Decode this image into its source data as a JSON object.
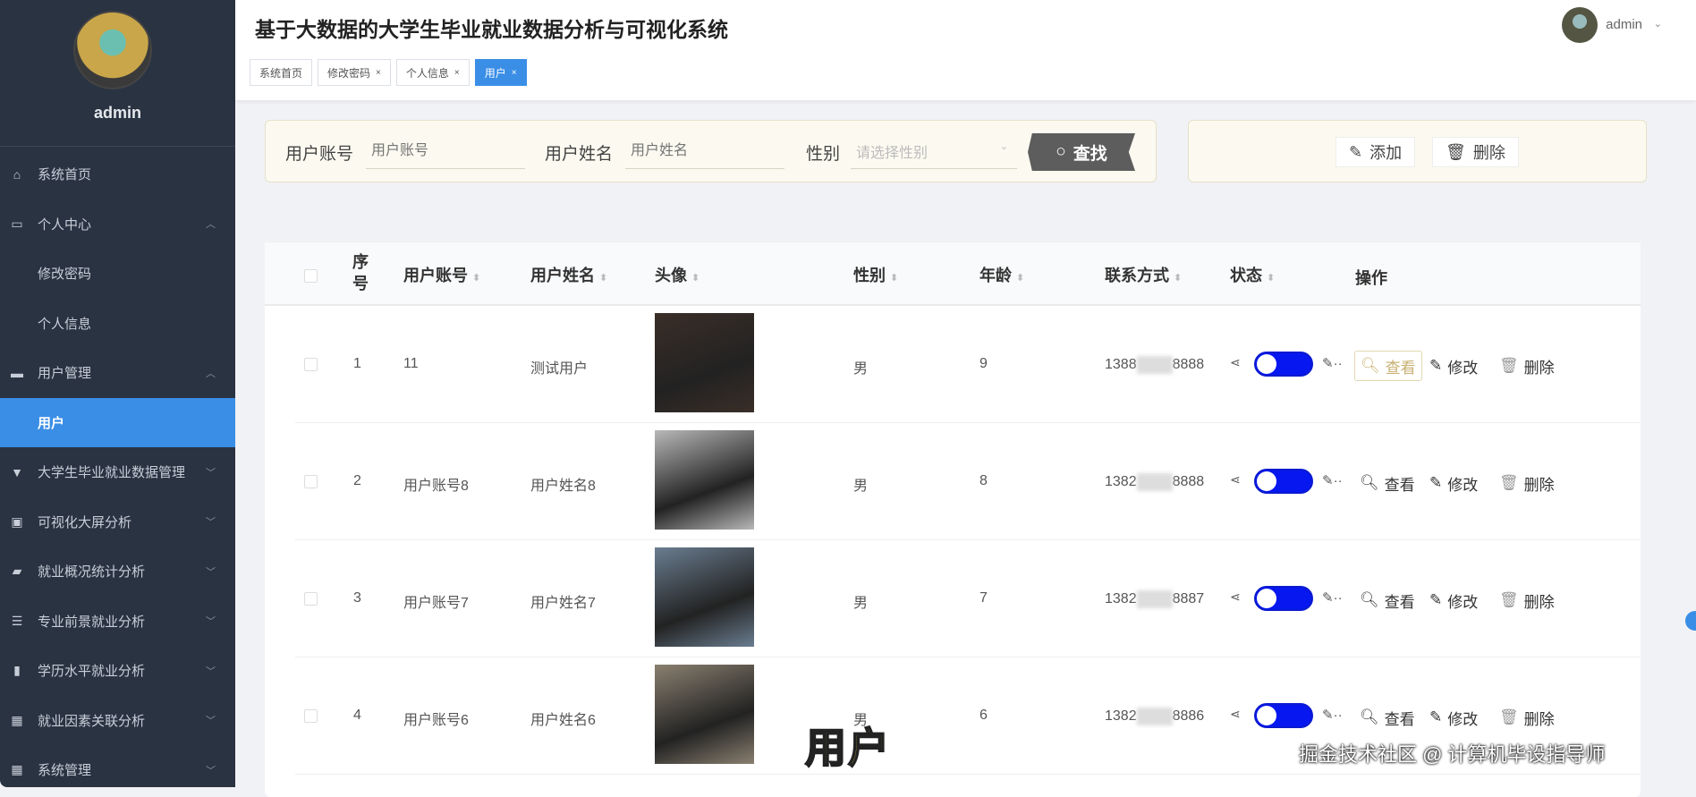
{
  "sidebar": {
    "username": "admin",
    "items": [
      {
        "label": "系统首页",
        "icon": "home-icon",
        "sub": false,
        "chev": ""
      },
      {
        "label": "个人中心",
        "icon": "card-icon",
        "sub": false,
        "chev": "^"
      },
      {
        "label": "修改密码",
        "sub": true
      },
      {
        "label": "个人信息",
        "sub": true
      },
      {
        "label": "用户管理",
        "icon": "wallet-icon",
        "sub": false,
        "chev": "^"
      },
      {
        "label": "用户",
        "sub": true,
        "active": true
      },
      {
        "label": "大学生毕业就业数据管理",
        "icon": "brush-icon",
        "chev": "v"
      },
      {
        "label": "可视化大屏分析",
        "icon": "clipboard-icon",
        "chev": "v"
      },
      {
        "label": "就业概况统计分析",
        "icon": "box-icon",
        "chev": "v"
      },
      {
        "label": "专业前景就业分析",
        "icon": "sliders-icon",
        "chev": "v"
      },
      {
        "label": "学历水平就业分析",
        "icon": "book-icon",
        "chev": "v"
      },
      {
        "label": "就业因素关联分析",
        "icon": "grid-icon",
        "chev": "v"
      },
      {
        "label": "系统管理",
        "icon": "apps-icon",
        "chev": "v"
      }
    ]
  },
  "header": {
    "title": "基于大数据的大学生毕业就业数据分析与可视化系统",
    "user": "admin",
    "tabs": [
      {
        "label": "系统首页",
        "closable": false
      },
      {
        "label": "修改密码",
        "closable": true
      },
      {
        "label": "个人信息",
        "closable": true
      },
      {
        "label": "用户",
        "closable": true,
        "active": true
      }
    ]
  },
  "search": {
    "account_label": "用户账号",
    "account_placeholder": "用户账号",
    "name_label": "用户姓名",
    "name_placeholder": "用户姓名",
    "gender_label": "性别",
    "gender_placeholder": "请选择性别",
    "find": "查找"
  },
  "actions": {
    "add": "添加",
    "delete": "删除"
  },
  "table": {
    "headers": {
      "index": "序号",
      "account": "用户账号",
      "name": "用户姓名",
      "avatar": "头像",
      "gender": "性别",
      "age": "年龄",
      "phone": "联系方式",
      "status": "状态",
      "ops": "操作"
    },
    "ops": {
      "view": "查看",
      "edit": "修改",
      "delete": "删除"
    },
    "rows": [
      {
        "index": "1",
        "account": "11",
        "name": "测试用户",
        "gender": "男",
        "age": "9",
        "phone_a": "1388",
        "phone_b": "8888",
        "status": true,
        "photo": "#3a2e28"
      },
      {
        "index": "2",
        "account": "用户账号8",
        "name": "用户姓名8",
        "gender": "男",
        "age": "8",
        "phone_a": "1382",
        "phone_b": "8888",
        "status": true,
        "photo": "#b8b8b8"
      },
      {
        "index": "3",
        "account": "用户账号7",
        "name": "用户姓名7",
        "gender": "男",
        "age": "7",
        "phone_a": "1382",
        "phone_b": "8887",
        "status": true,
        "photo": "#6a7d90"
      },
      {
        "index": "4",
        "account": "用户账号6",
        "name": "用户姓名6",
        "gender": "男",
        "age": "6",
        "phone_a": "1382",
        "phone_b": "8886",
        "status": true,
        "photo": "#8a8070"
      }
    ]
  },
  "overlay": {
    "caption": "用户",
    "watermark": "掘金技术社区 @ 计算机毕设指导师"
  }
}
